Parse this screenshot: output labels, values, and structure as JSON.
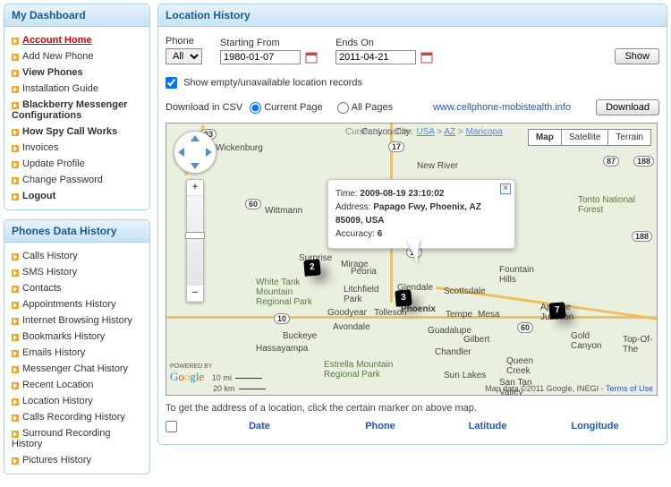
{
  "sidebar": {
    "dashboard_title": "My Dashboard",
    "phones_title": "Phones Data History",
    "dashboard_items": [
      {
        "label": "Account Home",
        "active": true
      },
      {
        "label": "Add New Phone"
      },
      {
        "label": "View Phones",
        "bold": true
      },
      {
        "label": "Installation Guide"
      },
      {
        "label": "Blackberry Messenger Configurations",
        "bold": true
      },
      {
        "label": "How Spy Call Works",
        "bold": true
      },
      {
        "label": "Invoices"
      },
      {
        "label": "Update Profile"
      },
      {
        "label": "Change Password"
      },
      {
        "label": "Logout",
        "bold": true
      }
    ],
    "history_items": [
      {
        "label": "Calls History"
      },
      {
        "label": "SMS History"
      },
      {
        "label": "Contacts"
      },
      {
        "label": "Appointments History"
      },
      {
        "label": "Internet Browsing History"
      },
      {
        "label": "Bookmarks History"
      },
      {
        "label": "Emails History"
      },
      {
        "label": "Messenger Chat History"
      },
      {
        "label": "Recent Location"
      },
      {
        "label": "Location History"
      },
      {
        "label": "Calls Recording History"
      },
      {
        "label": "Surround Recording History"
      },
      {
        "label": "Pictures History"
      }
    ]
  },
  "header": {
    "title": "Location History"
  },
  "filter": {
    "phone_label": "Phone",
    "phone_value": "All",
    "from_label": "Starting From",
    "from_value": "1980-01-07",
    "to_label": "Ends On",
    "to_value": "2011-04-21",
    "show_btn": "Show",
    "empty_check": "Show empty/unavailable location records"
  },
  "download": {
    "label": "Download in CSV",
    "opt_current": "Current Page",
    "opt_all": "All Pages",
    "btn": "Download",
    "link": "www.cellphone-mobistealth.info"
  },
  "map": {
    "breadcrumb_prefix": "Current Location:",
    "bc1": "USA",
    "bc2": "AZ",
    "bc3": "Maricopa",
    "type_map": "Map",
    "type_sat": "Satellite",
    "type_ter": "Terrain",
    "powered": "POWERED BY",
    "google": "Google",
    "scale1": "10 mi",
    "scale2": "20 km",
    "credit": "Map data ©2011 Google, INEGI - ",
    "terms": "Terms of Use",
    "info_time_lbl": "Time: ",
    "info_time": "2009-08-19 23:10:02",
    "info_addr_lbl": "Address: ",
    "info_addr": "Papago Fwy, Phoenix, AZ 85009, USA",
    "info_acc_lbl": "Accuracy: ",
    "info_acc": "6",
    "markers": [
      "2",
      "3",
      "7"
    ],
    "roads": {
      "r93": "93",
      "r17": "17",
      "r60a": "60",
      "r87": "87",
      "r188": "188",
      "r188b": "188",
      "r10": "10",
      "r60b": "60"
    },
    "cities": {
      "wickenburg": "Wickenburg",
      "canyon": "Canyon City",
      "newriver": "New River",
      "tonto": "Tonto National Forest",
      "wittmann": "Wittmann",
      "surprise": "Surprise",
      "mirage": "Mirage",
      "peoria": "Peoria",
      "fountain": "Fountain Hills",
      "wtm": "White Tank Mountain Regional Park",
      "litchfield": "Litchfield Park",
      "glendale": "Glendale",
      "scottsdale": "Scottsdale",
      "goodyear": "Goodyear",
      "tolleson": "Tolleson",
      "phoenix": "Phoenix",
      "tempe": "Tempe",
      "mesa": "Mesa",
      "apache": "Apache Junction",
      "avondale": "Avondale",
      "buckeye": "Buckeye",
      "guadalupe": "Guadalupe",
      "gilbert": "Gilbert",
      "goldcanyon": "Gold Canyon",
      "hassayampa": "Hassayampa",
      "chandler": "Chandler",
      "queencreek": "Queen Creek",
      "estrella": "Estrella Mountain Regional Park",
      "sunlakes": "Sun Lakes",
      "santan": "San Tan Valley",
      "topof": "Top-Of-The"
    }
  },
  "hint": "To get the address of a location, click the certain marker on above map.",
  "table": {
    "col_date": "Date",
    "col_phone": "Phone",
    "col_lat": "Latitude",
    "col_lon": "Longitude"
  }
}
